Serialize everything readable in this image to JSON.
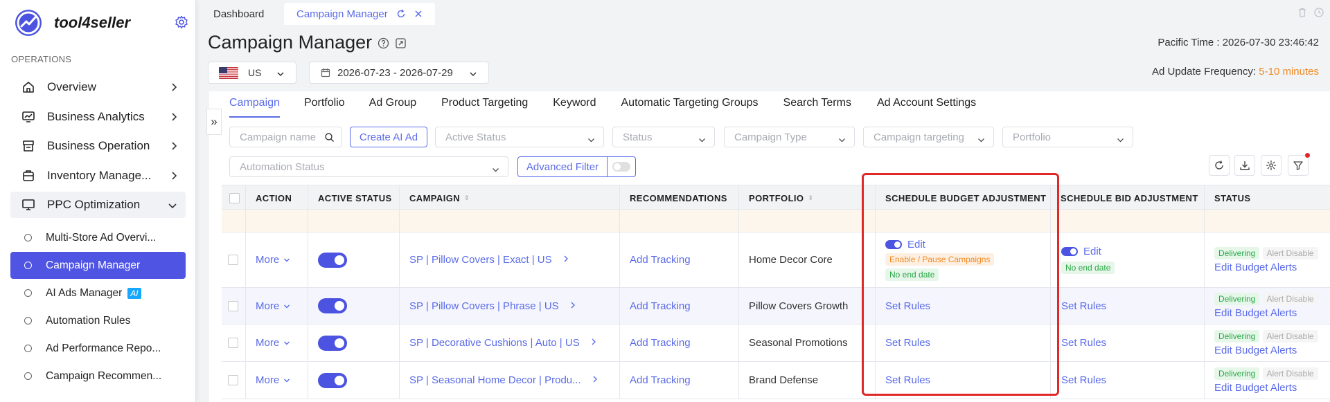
{
  "sidebar": {
    "brand": "tool4seller",
    "section_title": "OPERATIONS",
    "items": [
      {
        "label": "Overview",
        "icon": "home-icon"
      },
      {
        "label": "Business Analytics",
        "icon": "chart-icon"
      },
      {
        "label": "Business Operation",
        "icon": "store-icon"
      },
      {
        "label": "Inventory Manage...",
        "icon": "inventory-icon"
      },
      {
        "label": "PPC Optimization",
        "icon": "monitor-icon"
      }
    ],
    "sub_items": [
      {
        "label": "Multi-Store Ad Overvi..."
      },
      {
        "label": "Campaign Manager"
      },
      {
        "label": "AI Ads Manager",
        "badge": "AI"
      },
      {
        "label": "Automation Rules"
      },
      {
        "label": "Ad Performance Repo..."
      },
      {
        "label": "Campaign Recommen..."
      }
    ]
  },
  "topbar": {
    "tabs": [
      "Dashboard",
      "Campaign Manager"
    ]
  },
  "header": {
    "title": "Campaign Manager",
    "pacific_time": "Pacific Time :  2026-07-30 23:46:42",
    "freq_label": "Ad Update Frequency: ",
    "freq_value": "5-10 minutes",
    "country": "US",
    "date_range": "2026-07-23 - 2026-07-29"
  },
  "subtabs": [
    "Campaign",
    "Portfolio",
    "Ad Group",
    "Product Targeting",
    "Keyword",
    "Automatic Targeting Groups",
    "Search Terms",
    "Ad Account Settings"
  ],
  "filters": {
    "campaign_name_placeholder": "Campaign name",
    "create_ai_ad": "Create AI Ad",
    "active_status": "Active Status",
    "status": "Status",
    "campaign_type": "Campaign Type",
    "campaign_targeting": "Campaign targeting",
    "portfolio": "Portfolio",
    "automation_status": "Automation Status",
    "advanced_filter": "Advanced Filter"
  },
  "table": {
    "headers": [
      "ACTION",
      "ACTIVE STATUS",
      "CAMPAIGN",
      "RECOMMENDATIONS",
      "PORTFOLIO",
      "SCHEDULE BUDGET ADJUSTMENT",
      "SCHEDULE BID ADJUSTMENT",
      "STATUS"
    ],
    "rows": [
      {
        "action": "More",
        "campaign": "SP | Pillow Covers | Exact | US",
        "recommendation": "Add Tracking",
        "portfolio": "Home Decor Core",
        "budget_edit": "Edit",
        "budget_tag1": "Enable / Pause Campaigns",
        "budget_tag2": "No end date",
        "bid_edit": "Edit",
        "bid_tag": "No end date",
        "status": "Delivering",
        "alert": "Alert Disable",
        "alert_link": "Edit Budget Alerts"
      },
      {
        "action": "More",
        "campaign": "SP | Pillow Covers | Phrase | US",
        "recommendation": "Add Tracking",
        "portfolio": "Pillow Covers Growth",
        "budget": "Set Rules",
        "bid": "Set Rules",
        "status": "Delivering",
        "alert": "Alert Disable",
        "alert_link": "Edit Budget Alerts"
      },
      {
        "action": "More",
        "campaign": "SP | Decorative Cushions | Auto | US",
        "recommendation": "Add Tracking",
        "portfolio": "Seasonal Promotions",
        "budget": "Set Rules",
        "bid": "Set Rules",
        "status": "Delivering",
        "alert": "Alert Disable",
        "alert_link": "Edit Budget Alerts"
      },
      {
        "action": "More",
        "campaign": "SP | Seasonal Home Decor | Produ...",
        "recommendation": "Add Tracking",
        "portfolio": "Brand Defense",
        "budget": "Set Rules",
        "bid": "Set Rules",
        "status": "Delivering",
        "alert": "Alert Disable",
        "alert_link": "Edit Budget Alerts"
      }
    ]
  },
  "colors": {
    "accent": "#5a6be8",
    "brand": "#4b53e0",
    "orange": "#f08a24",
    "green": "#28a745",
    "highlight": "#e02828"
  }
}
